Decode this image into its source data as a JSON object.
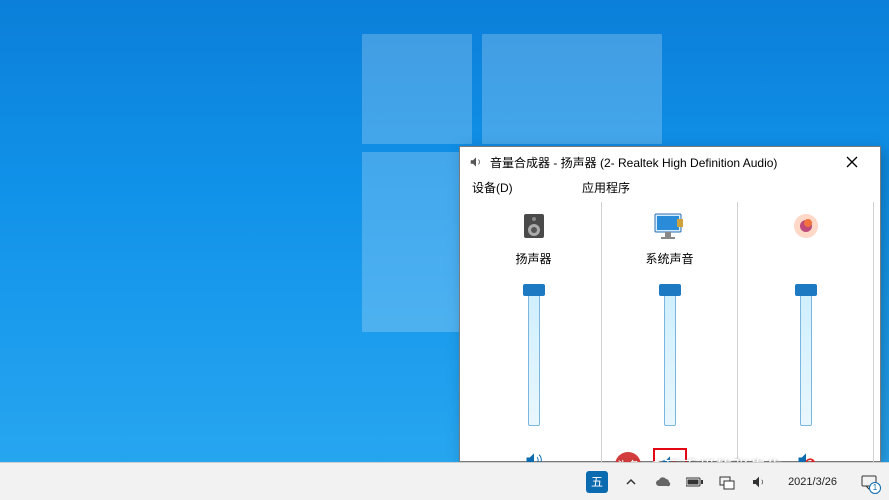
{
  "mixer": {
    "title": "音量合成器 - 扬声器 (2- Realtek High Definition Audio)",
    "section_device": "设备(D)",
    "section_apps": "应用程序",
    "columns": [
      {
        "label": "扬声器",
        "muted": false
      },
      {
        "label": "系统声音",
        "muted": true,
        "highlighted": true
      },
      {
        "label": "",
        "muted": true
      }
    ]
  },
  "taskbar": {
    "ime": "五",
    "time": "",
    "date": "2021/3/26",
    "notif_count": "1"
  },
  "watermark": {
    "badge": "头条",
    "text": "@玩手机的张先生"
  }
}
